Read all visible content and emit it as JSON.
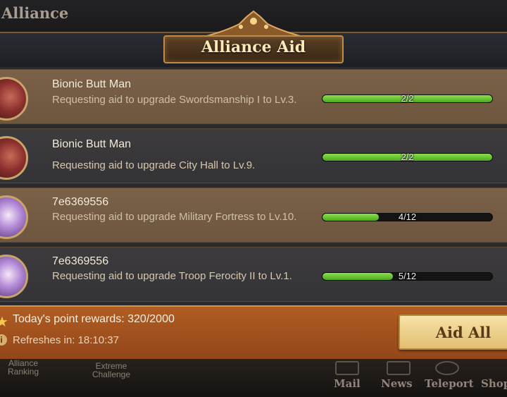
{
  "screen": {
    "title": "Alliance"
  },
  "panel": {
    "title": "Alliance Aid"
  },
  "requests": [
    {
      "name": "Bionic Butt Man",
      "desc": "Requesting aid to upgrade Swordsmanship I to Lv.3.",
      "progress": "2/2",
      "fill": 1.0
    },
    {
      "name": "Bionic Butt Man",
      "desc": "Requesting aid to upgrade City Hall to Lv.9.",
      "progress": "2/2",
      "fill": 1.0
    },
    {
      "name": "7e6369556",
      "desc": "Requesting aid to upgrade Military Fortress to Lv.10.",
      "progress": "4/12",
      "fill": 0.333
    },
    {
      "name": "7e6369556",
      "desc": "Requesting aid to upgrade Troop Ferocity II to Lv.1.",
      "progress": "5/12",
      "fill": 0.4167
    }
  ],
  "footer": {
    "points": "Today's point rewards: 320/2000",
    "refresh": "Refreshes in: 18:10:37",
    "aid_all": "Aid All"
  },
  "bottom_nav": {
    "alliance_ranking": "Alliance\nRanking",
    "extreme_challenge": "Extreme\nChallenge",
    "mail": "Mail",
    "news": "News",
    "teleport": "Teleport",
    "shop": "Shop"
  },
  "icons": {
    "star": "star-icon",
    "info": "info-icon",
    "mail": "mail-icon",
    "news": "news-icon",
    "teleport": "teleport-icon"
  },
  "colors": {
    "progress_green": "#5cc22e",
    "footer_orange": "#a4511e",
    "button_gold": "#ecd08a"
  }
}
